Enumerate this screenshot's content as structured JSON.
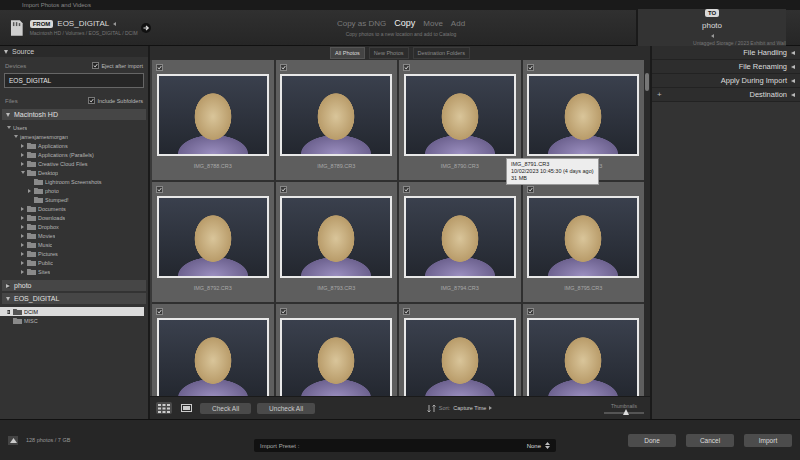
{
  "window": {
    "title": "Import Photos and Videos"
  },
  "source_bar": {
    "badge": "FROM",
    "name": "EOS_DIGITAL",
    "path": "Macintosh HD / Volumes / EOS_DIGITAL / DCIM"
  },
  "modes": {
    "options": [
      {
        "label": "Copy as DNG",
        "selected": false
      },
      {
        "label": "Copy",
        "selected": true
      },
      {
        "label": "Move",
        "selected": false
      },
      {
        "label": "Add",
        "selected": false
      }
    ],
    "description": "Copy photos to a new location and add to Catalog"
  },
  "destination_bar": {
    "badge": "TO",
    "name": "photo",
    "path": "Untagged Storage / 2023 Exhibit and Wall"
  },
  "sidebar": {
    "header": "Source",
    "devices_label": "Devices",
    "eject": {
      "label": "Eject after import",
      "checked": true
    },
    "devices": [
      {
        "label": "EOS_DIGITAL",
        "selected": true
      }
    ],
    "files_label": "Files",
    "subfolders": {
      "label": "Include Subfolders",
      "checked": true
    },
    "volumes": [
      {
        "name": "Macintosh HD",
        "expanded": true,
        "tree": [
          {
            "label": "Users",
            "kind": "place",
            "expanded": true,
            "selected": false,
            "children": [
              {
                "label": "jamesjamesmorgan",
                "kind": "place",
                "expanded": true,
                "selected": false,
                "children": [
                  {
                    "label": "Applications",
                    "kind": "folder",
                    "expanded": false,
                    "selected": false
                  },
                  {
                    "label": "Applications (Parallels)",
                    "kind": "folder",
                    "expanded": false,
                    "selected": false
                  },
                  {
                    "label": "Creative Cloud Files",
                    "kind": "folder",
                    "expanded": false,
                    "selected": false
                  },
                  {
                    "label": "Desktop",
                    "kind": "folder",
                    "expanded": true,
                    "selected": false,
                    "children": [
                      {
                        "label": "Lightroom Screenshots",
                        "kind": "folder",
                        "selected": false
                      },
                      {
                        "label": "photo",
                        "kind": "folder",
                        "expanded": false,
                        "selected": false
                      },
                      {
                        "label": "Stumped!",
                        "kind": "folder",
                        "selected": false
                      }
                    ]
                  },
                  {
                    "label": "Documents",
                    "kind": "folder",
                    "expanded": false,
                    "selected": false
                  },
                  {
                    "label": "Downloads",
                    "kind": "folder",
                    "expanded": false,
                    "selected": false
                  },
                  {
                    "label": "Dropbox",
                    "kind": "folder",
                    "expanded": false,
                    "selected": false
                  },
                  {
                    "label": "Movies",
                    "kind": "folder",
                    "expanded": false,
                    "selected": false
                  },
                  {
                    "label": "Music",
                    "kind": "folder",
                    "expanded": false,
                    "selected": false
                  },
                  {
                    "label": "Pictures",
                    "kind": "folder",
                    "expanded": false,
                    "selected": false
                  },
                  {
                    "label": "Public",
                    "kind": "folder",
                    "expanded": false,
                    "selected": false
                  },
                  {
                    "label": "Sites",
                    "kind": "folder",
                    "expanded": false,
                    "selected": false
                  }
                ]
              }
            ]
          }
        ]
      },
      {
        "name": "photo",
        "expanded": false,
        "tree": []
      },
      {
        "name": "EOS_DIGITAL",
        "expanded": true,
        "tree": [
          {
            "label": "DCIM",
            "kind": "folder",
            "expanded": false,
            "selected": true
          },
          {
            "label": "MISC",
            "kind": "folder",
            "selected": false
          }
        ]
      }
    ]
  },
  "grid": {
    "tabs": [
      {
        "label": "All Photos",
        "selected": true
      },
      {
        "label": "New Photos",
        "selected": false
      },
      {
        "label": "Destination Folders",
        "selected": false
      }
    ],
    "photos": [
      {
        "name": "IMG_8788.CR3",
        "checked": true
      },
      {
        "name": "IMG_8789.CR3",
        "checked": true
      },
      {
        "name": "IMG_8790.CR3",
        "checked": true
      },
      {
        "name": "IMG_8791.CR3",
        "checked": true
      },
      {
        "name": "IMG_8792.CR3",
        "checked": true
      },
      {
        "name": "IMG_8793.CR3",
        "checked": true
      },
      {
        "name": "IMG_8794.CR3",
        "checked": true
      },
      {
        "name": "IMG_8795.CR3",
        "checked": true
      },
      {
        "checked": true
      },
      {
        "checked": true
      },
      {
        "checked": true
      },
      {
        "checked": true
      }
    ],
    "scroll_level": 0.04,
    "tooltip": {
      "lines": [
        "IMG_8791.CR3",
        "10/02/2023 10:45:30 (4 days ago)",
        "31 MB"
      ]
    }
  },
  "toolbar": {
    "views": [
      {
        "kind": "grid",
        "selected": true
      },
      {
        "kind": "loupe",
        "selected": false
      }
    ],
    "buttons": [
      "Check All",
      "Uncheck All"
    ],
    "sort": {
      "label": "Sort:",
      "value": "Capture Time"
    },
    "thumbnails": {
      "label": "Thumbnails",
      "level": 0.55
    }
  },
  "panels": [
    {
      "label": "File Handling",
      "expanded": false
    },
    {
      "label": "File Renaming",
      "expanded": false
    },
    {
      "label": "Apply During Import",
      "expanded": false
    },
    {
      "label": "Destination",
      "expanded": false,
      "prefix": "+"
    }
  ],
  "status": {
    "summary": "128 photos / 7 GB",
    "preset_label": "Import Preset :",
    "preset_value": "None",
    "buttons": [
      "Done",
      "Cancel",
      "Import"
    ]
  }
}
